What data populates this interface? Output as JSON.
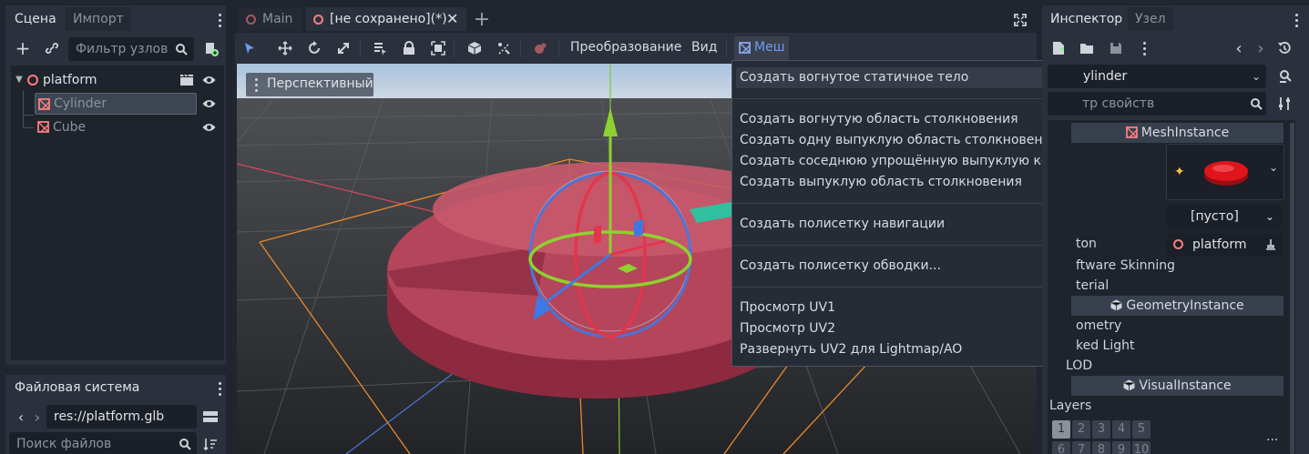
{
  "scene_dock": {
    "tabs": [
      "Сцена",
      "Импорт"
    ],
    "filter_placeholder": "Фильтр узлов",
    "tree": [
      {
        "label": "platform",
        "kind": "root"
      },
      {
        "label": "Cylinder",
        "kind": "mesh"
      },
      {
        "label": "Cube",
        "kind": "mesh"
      }
    ]
  },
  "filesystem_dock": {
    "title": "Файловая система",
    "path": "res://platform.glb",
    "search_placeholder": "Поиск файлов"
  },
  "editor_tabs": [
    "Main",
    "[не сохранено](*)"
  ],
  "toolbar": {
    "transform_menu": "Преобразование",
    "view_menu": "Вид",
    "mesh_menu": "Меш"
  },
  "viewport": {
    "perspective_label": "Перспективный"
  },
  "mesh_menu": {
    "items": [
      "Создать вогнутое статичное тело",
      "Создать вогнутую область столкновения",
      "Создать одну выпуклую область столкновения",
      "Создать соседнюю упрощённую выпуклую коллизию",
      "Создать выпуклую область столкновения",
      "Создать полисетку навигации",
      "Создать полисетку обводки...",
      "Просмотр UV1",
      "Просмотр UV2",
      "Развернуть UV2 для Lightmap/AO"
    ]
  },
  "inspector": {
    "tabs": [
      "Инспектор",
      "Узел"
    ],
    "object_name": "ylinder",
    "filter_placeholder": "тр свойств",
    "sections": {
      "mesh_instance": "MeshInstance",
      "geometry_instance": "GeometryInstance",
      "visual_instance": "VisualInstance"
    },
    "empty_value": "[пусто]",
    "skeleton_label": "ton",
    "skeleton_value": "platform",
    "software_skinning": "ftware Skinning",
    "material": "terial",
    "geometry": "ometry",
    "baked_light": "ked Light",
    "lod": "LOD",
    "layers_label": "Layers",
    "layers_row1": [
      "1",
      "2",
      "3",
      "4",
      "5"
    ],
    "layers_row2": [
      "6",
      "7",
      "8",
      "9",
      "10"
    ],
    "more": "..."
  },
  "colors": {
    "accent": "#6e9bf5",
    "mesh_icon": "#fc7f7f",
    "platform_red": "#a8344c"
  }
}
